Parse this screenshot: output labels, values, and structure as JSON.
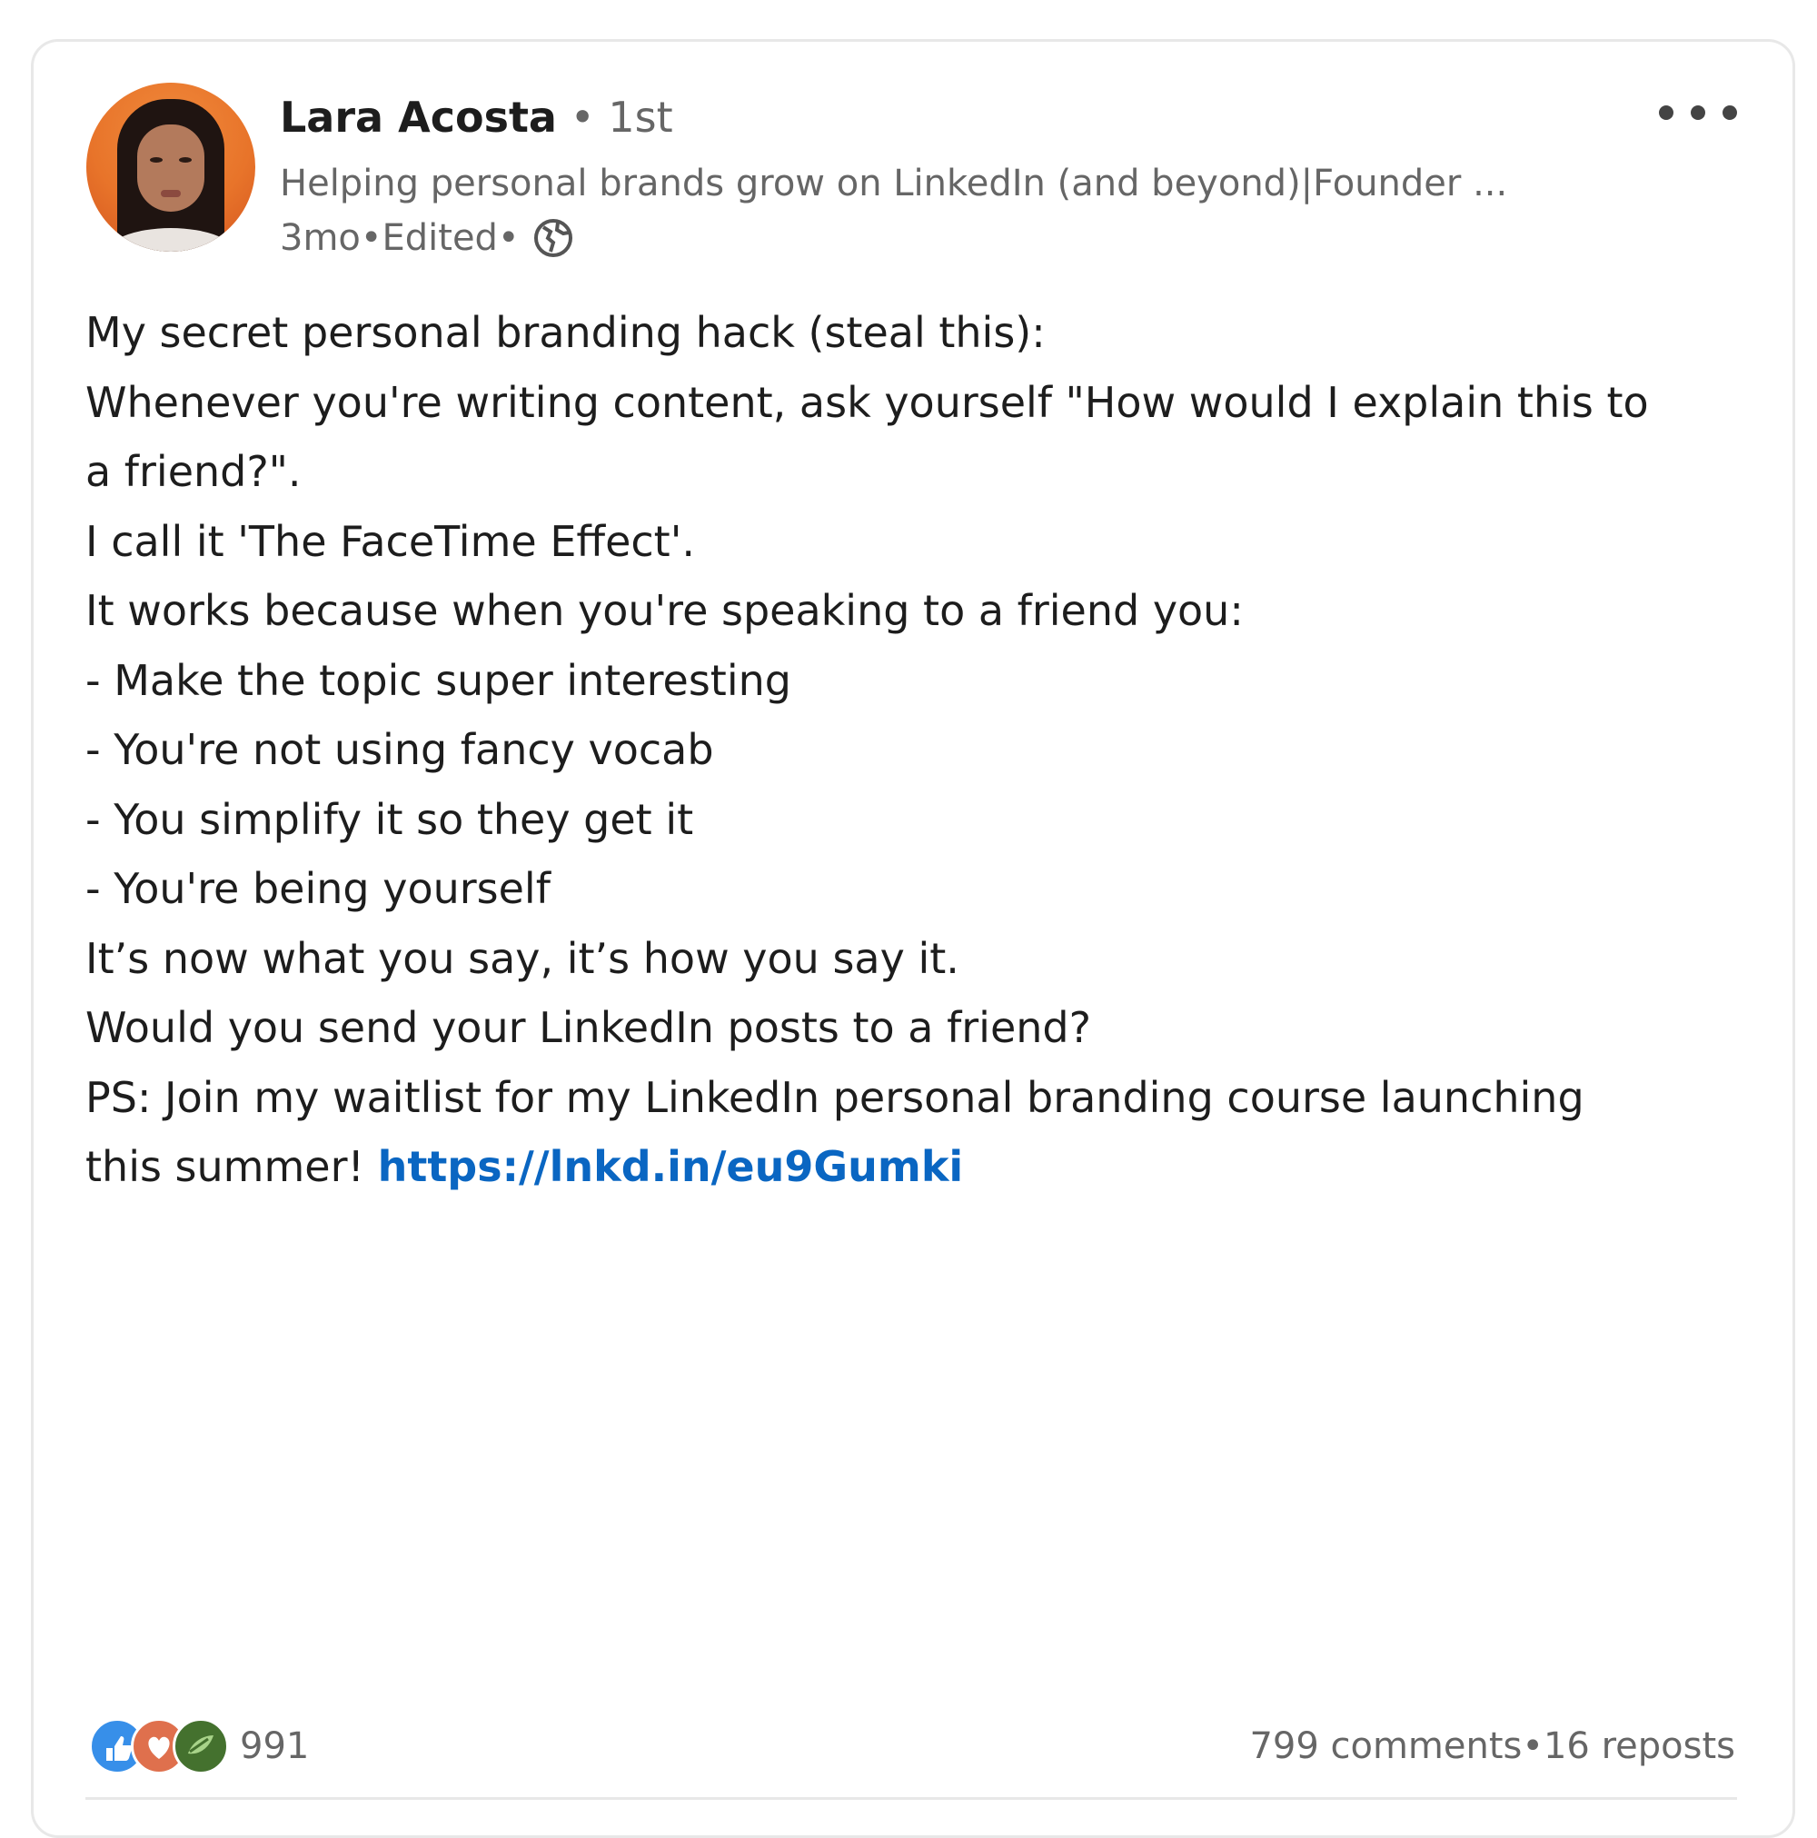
{
  "author": {
    "name": "Lara Acosta",
    "degree_sep": " • ",
    "degree": "1st",
    "headline": "Helping personal brands grow on LinkedIn (and beyond)|Founder ...",
    "time": "3mo",
    "sep1": " • ",
    "edited": "Edited",
    "sep2": " •",
    "visibility_icon": "globe-icon"
  },
  "menu": {
    "icon": "more-horizontal-icon"
  },
  "post": {
    "lines": [
      "My secret personal branding hack (steal this):",
      "",
      "Whenever you're writing content, ask yourself \"How would I explain this to",
      "a friend?\".",
      "",
      "I call it 'The FaceTime Effect'.",
      "",
      "It works because when you're speaking to a friend you:",
      "",
      "- Make the topic super interesting",
      "- You're not using fancy vocab",
      "- You simplify it so they get it",
      "- You're being yourself",
      "",
      "It’s now what you say, it’s how you say it.",
      "",
      "Would you send your LinkedIn posts to a friend?",
      "",
      "PS: Join my waitlist for my LinkedIn personal branding course launching"
    ],
    "last_line_prefix": "this summer! ",
    "link": "https://lnkd.in/eu9Gumki"
  },
  "social": {
    "reaction_icons": [
      "like-icon",
      "love-icon",
      "support-icon"
    ],
    "reaction_count": "991",
    "comments": "799 comments",
    "sep": " • ",
    "reposts": "16 reposts"
  },
  "colors": {
    "link": "#0a66c2",
    "like": "#378fe9",
    "love": "#df704d",
    "support": "#44712e"
  }
}
